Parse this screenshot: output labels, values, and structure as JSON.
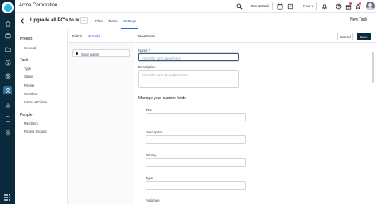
{
  "app": {
    "org_name": "Acme Corporation",
    "accent": "#2563eb",
    "rail_color": "#0b2a3c"
  },
  "rail": {
    "icons": [
      "home-icon",
      "briefcase-icon",
      "folder-icon",
      "clock-icon",
      "dollar-icon",
      "chart-icon",
      "people-icon",
      "file-icon",
      "gear-icon",
      "settings-icon",
      "apps-grid-icon"
    ]
  },
  "topbar": {
    "get_started": "Get started",
    "new_label": "New",
    "icons": [
      "search-icon",
      "calendar-icon",
      "timer-icon",
      "bell-icon",
      "help-icon",
      "gift-icon",
      "star-icon"
    ]
  },
  "project": {
    "name": "Upgrade all PC's to w...",
    "more": "···",
    "tabs": [
      "Plan",
      "Tasks",
      "Settings"
    ],
    "active_tab": "Settings",
    "new_task": "New Task"
  },
  "sidebar": {
    "sections": [
      {
        "title": "Project",
        "items": [
          "General"
        ]
      },
      {
        "title": "Task",
        "items": [
          "Type",
          "Status",
          "Priority",
          "Workflow",
          "Forms & Fields"
        ]
      },
      {
        "title": "People",
        "items": [
          "Members",
          "Project Groups"
        ]
      }
    ]
  },
  "fields": {
    "header_label": "Fields",
    "add_field": "⊕ Field",
    "items": [
      "Story points"
    ]
  },
  "form": {
    "title": "New Form",
    "cancel": "Cancel",
    "save": "Save",
    "name_label": "Name *",
    "name_placeholder": "Enter the form name here",
    "description_label": "Description",
    "description_placeholder": "Enter the form description here",
    "custom_fields_title": "Manage your custom fields",
    "custom_fields": [
      "Title",
      "Description",
      "Priority",
      "Type",
      "Assignee"
    ]
  }
}
